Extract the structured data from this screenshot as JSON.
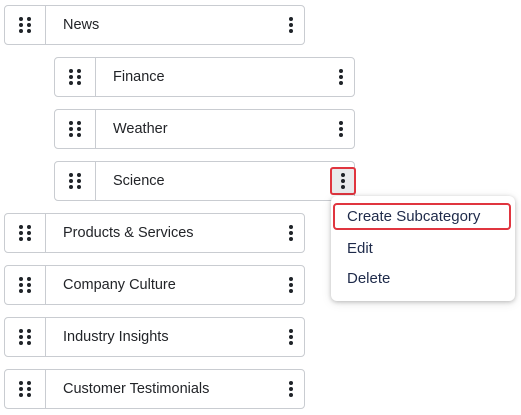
{
  "categories": [
    {
      "label": "News",
      "level": "top"
    },
    {
      "label": "Finance",
      "level": "sub"
    },
    {
      "label": "Weather",
      "level": "sub"
    },
    {
      "label": "Science",
      "level": "sub"
    },
    {
      "label": "Products & Services",
      "level": "top"
    },
    {
      "label": "Company Culture",
      "level": "top"
    },
    {
      "label": "Industry Insights",
      "level": "top"
    },
    {
      "label": "Customer Testimonials",
      "level": "top"
    }
  ],
  "context_menu": {
    "items": [
      "Create Subcategory",
      "Edit",
      "Delete"
    ],
    "highlighted": "Create Subcategory"
  },
  "icons": {
    "drag": "drag-handle-icon",
    "more": "kebab-menu-icon"
  },
  "colors": {
    "border": "#c9ccd1",
    "highlight": "#e0353f",
    "menu_text": "#1e2a4a"
  }
}
